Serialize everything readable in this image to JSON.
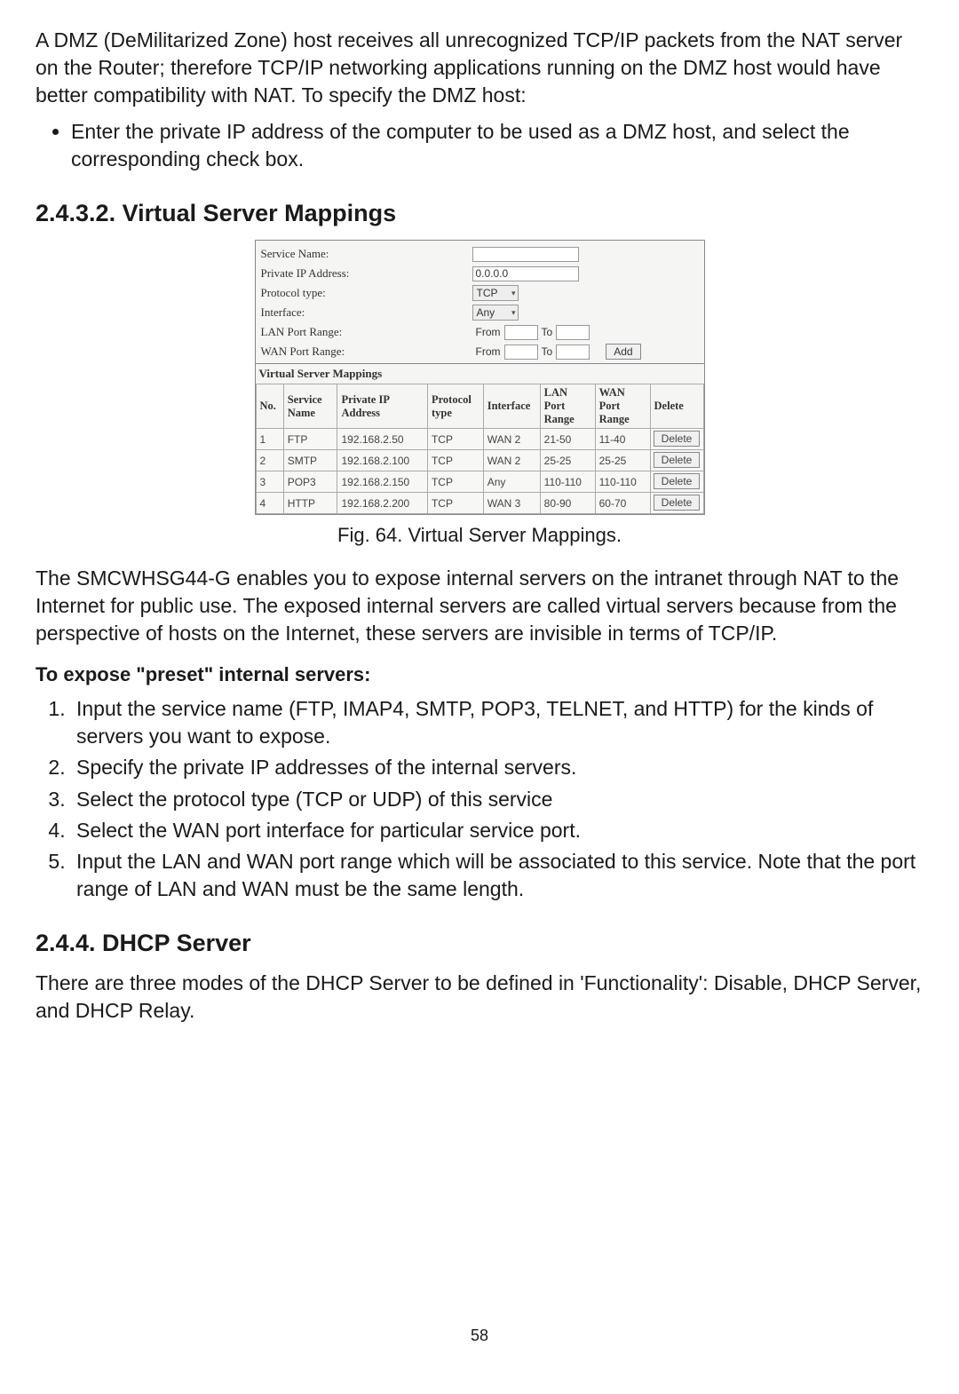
{
  "intro": {
    "p1": "A DMZ (DeMilitarized Zone) host receives all unrecognized TCP/IP packets from the NAT server on the Router; therefore TCP/IP networking applications running on the DMZ host would have better compatibility with NAT. To specify the DMZ host:",
    "bullet": "Enter the private IP address of the computer to be used as a DMZ host, and select the corresponding check box."
  },
  "heading_vsm": "2.4.3.2. Virtual Server Mappings",
  "figure": {
    "labels": {
      "service_name": "Service Name:",
      "private_ip": "Private IP Address:",
      "protocol_type": "Protocol type:",
      "interface": "Interface:",
      "lan_port_range": "LAN Port Range:",
      "wan_port_range": "WAN Port Range:",
      "from": "From",
      "to": "To",
      "section_title": "Virtual Server Mappings",
      "add_button": "Add",
      "delete_button": "Delete"
    },
    "values": {
      "service_name": "",
      "private_ip": "0.0.0.0",
      "protocol_type": "TCP",
      "interface": "Any",
      "lan_from": "",
      "lan_to": "",
      "wan_from": "",
      "wan_to": ""
    },
    "table": {
      "headers": {
        "no": "No.",
        "service": "Service Name",
        "ip": "Private IP Address",
        "proto": "Protocol type",
        "iface": "Interface",
        "lan": "LAN Port Range",
        "wan": "WAN Port Range",
        "del": "Delete"
      },
      "rows": [
        {
          "no": "1",
          "service": "FTP",
          "ip": "192.168.2.50",
          "proto": "TCP",
          "iface": "WAN 2",
          "lan": "21-50",
          "wan": "11-40"
        },
        {
          "no": "2",
          "service": "SMTP",
          "ip": "192.168.2.100",
          "proto": "TCP",
          "iface": "WAN 2",
          "lan": "25-25",
          "wan": "25-25"
        },
        {
          "no": "3",
          "service": "POP3",
          "ip": "192.168.2.150",
          "proto": "TCP",
          "iface": "Any",
          "lan": "110-110",
          "wan": "110-110"
        },
        {
          "no": "4",
          "service": "HTTP",
          "ip": "192.168.2.200",
          "proto": "TCP",
          "iface": "WAN 3",
          "lan": "80-90",
          "wan": "60-70"
        }
      ]
    },
    "caption": "Fig. 64. Virtual Server Mappings."
  },
  "after_figure": {
    "p1": "The SMCWHSG44-G enables you to expose internal servers on the intranet through NAT to the Internet for public use. The exposed internal servers are called virtual servers because from the perspective of hosts on the Internet, these servers are invisible in terms of TCP/IP.",
    "bold": "To expose \"preset\" internal servers:",
    "steps": [
      "Input the service name (FTP, IMAP4, SMTP, POP3, TELNET, and HTTP) for the kinds of servers you want to expose.",
      "Specify the private IP addresses of the internal servers.",
      "Select the protocol type (TCP or UDP) of this service",
      "Select the WAN port interface for particular service port.",
      "Input the LAN and WAN port range which will be associated to this service. Note that the port range of LAN and WAN must be the same length."
    ]
  },
  "heading_dhcp": "2.4.4. DHCP Server",
  "dhcp_p": "There are three modes of the DHCP Server to be defined in 'Functionality': Disable, DHCP Server, and DHCP Relay.",
  "page_number": "58"
}
